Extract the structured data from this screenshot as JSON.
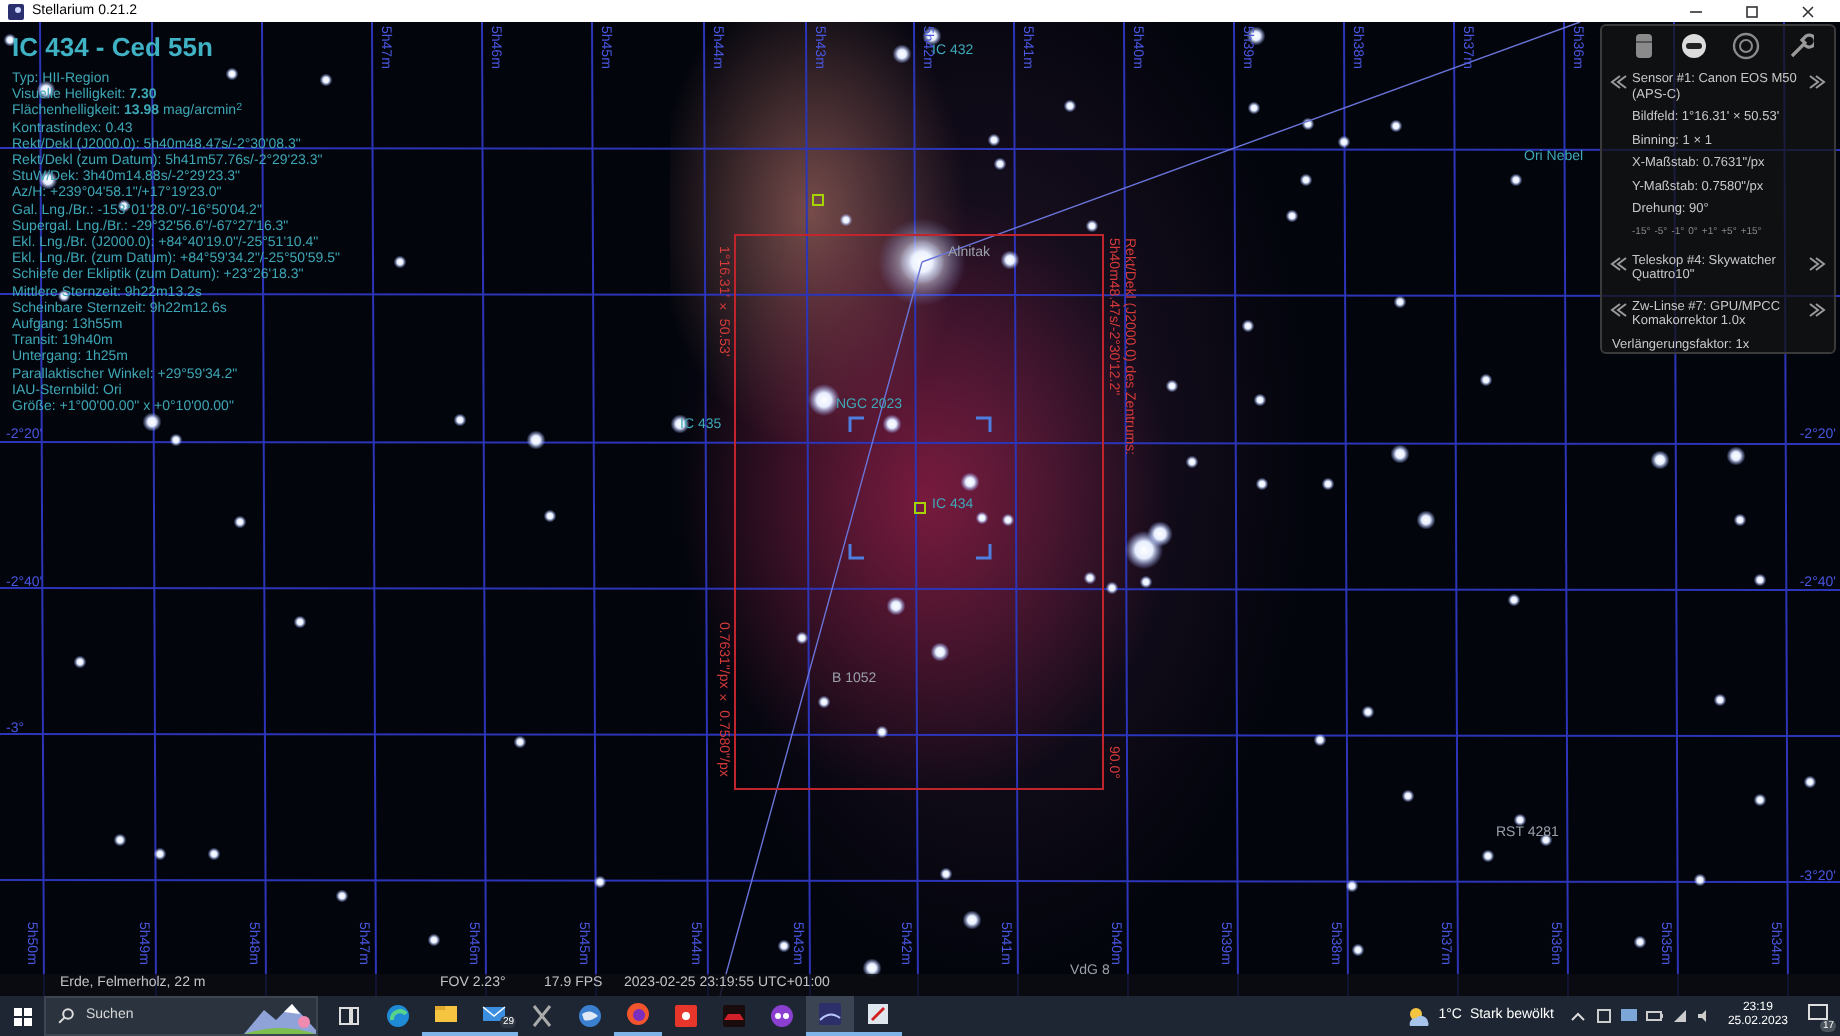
{
  "window": {
    "title": "Stellarium 0.21.2"
  },
  "info": {
    "title": "IC 434 - Ced 55n",
    "lines": [
      "Typ: HII-Region",
      "Visuelle Helligkeit: **7.30**",
      "Flächenhelligkeit: **13.98** mag/arcmin$^{2}$",
      "Kontrastindex: 0.43",
      "Rekt/Dekl (J2000.0): 5h40m48.47s/-2°30'08.3\"",
      "Rekt/Dekl (zum Datum): 5h41m57.76s/-2°29'23.3\"",
      "StuW/Dek: 3h40m14.88s/-2°29'23.3\"",
      "Az/H: +239°04'58.1\"/+17°19'23.0\"",
      "Gal. Lng./Br.: -153°01'28.0\"/-16°50'04.2\"",
      "Supergal. Lng./Br.: -29°32'56.6\"/-67°27'16.3\"",
      "Ekl. Lng./Br. (J2000.0): +84°40'19.0\"/-25°51'10.4\"",
      "Ekl. Lng./Br. (zum Datum): +84°59'34.2\"/-25°50'59.5\"",
      "Schiefe der Ekliptik (zum Datum): +23°26'18.3\"",
      "Mittlere Sternzeit: 9h22m13.2s",
      "Scheinbare Sternzeit: 9h22m12.6s",
      "Aufgang: 13h55m",
      "Transit: 19h40m",
      "Untergang: 1h25m",
      "Parallaktischer Winkel: +29°59'34.2\"",
      "IAU-Sternbild: Ori",
      "Größe: +1°00'00.00\" x +0°10'00.00\""
    ]
  },
  "sky": {
    "ra_top": [
      "5h47m",
      "5h46m",
      "5h45m",
      "5h44m",
      "5h43m",
      "5h42m",
      "5h41m",
      "5h40m",
      "5h39m",
      "5h38m",
      "5h37m",
      "5h36m"
    ],
    "ra_bottom": [
      "5h50m",
      "5h49m",
      "5h48m",
      "5h47m",
      "5h46m",
      "5h45m",
      "5h44m",
      "5h43m",
      "5h42m",
      "5h41m",
      "5h40m",
      "5h39m",
      "5h38m",
      "5h37m",
      "5h36m",
      "5h35m",
      "5h34m"
    ],
    "dec_left": [
      "-2°20'",
      "-2°40'",
      "-3°"
    ],
    "dec_right": [
      "-2°20'",
      "-2°40'",
      "-3°20'"
    ],
    "objects": [
      {
        "text": "IC 432",
        "kind": "nebula"
      },
      {
        "text": "Alnitak",
        "kind": "star"
      },
      {
        "text": "NGC 2023",
        "kind": "nebula"
      },
      {
        "text": "IC 435",
        "kind": "nebula"
      },
      {
        "text": "IC 434",
        "kind": "nebula"
      },
      {
        "text": "B 1052",
        "kind": "star"
      },
      {
        "text": "RST 4281",
        "kind": "star"
      },
      {
        "text": "VdG 8",
        "kind": "star"
      },
      {
        "text": "Ori Nebel",
        "kind": "nebula"
      }
    ],
    "frame_labels": [
      "1°16.31' × 50.53'",
      "0.7631\"/px × 0.7580\"/px",
      "Rekt/Dekl (J2000.0) des Zentrums:",
      "5h40m48.47s/-2°30'12.2\"",
      "90.0°"
    ]
  },
  "oculars": {
    "sensor": {
      "title": "Sensor #1: Canon EOS M50 (APS-C)",
      "details": [
        "Bildfeld: 1°16.31' × 50.53'",
        "Binning: 1 × 1",
        "X-Maßstab: 0.7631\"/px",
        "Y-Maßstab: 0.7580\"/px",
        "Drehung: 90°"
      ],
      "rotation_buttons": [
        "-15°",
        "-5°",
        "-1°",
        "0°",
        "+1°",
        "+5°",
        "+15°"
      ]
    },
    "telescope": {
      "title": "Teleskop #4: Skywatcher Quattro10\""
    },
    "lens": {
      "title": "Zw-Linse #7: GPU/MPCC Komakorrektor 1.0x",
      "details": [
        "Verlängerungsfaktor: 1x"
      ]
    }
  },
  "status_bar": {
    "location": "Erde, Felmerholz, 22 m",
    "fov": "FOV 2.23°",
    "fps": "17.9 FPS",
    "datetime": "2023-02-25 23:19:55 UTC+01:00"
  },
  "taskbar": {
    "search_placeholder": "Suchen",
    "apps": [
      {
        "kind": "task-view",
        "running": false,
        "selected": false
      },
      {
        "kind": "edge",
        "running": false,
        "selected": false
      },
      {
        "kind": "explorer",
        "running": true,
        "selected": false
      },
      {
        "kind": "mail",
        "running": true,
        "selected": false,
        "badge": "29"
      },
      {
        "kind": "xapp",
        "running": false,
        "selected": false
      },
      {
        "kind": "globe",
        "running": false,
        "selected": false
      },
      {
        "kind": "firefox",
        "running": true,
        "selected": false
      },
      {
        "kind": "record",
        "running": false,
        "selected": false
      },
      {
        "kind": "car",
        "running": false,
        "selected": false
      },
      {
        "kind": "mascot",
        "running": false,
        "selected": false
      },
      {
        "kind": "stellarium",
        "running": true,
        "selected": true
      },
      {
        "kind": "tool",
        "running": true,
        "selected": false
      }
    ],
    "weather": {
      "temperature": "1°C",
      "condition": "Stark bewölkt"
    },
    "clock": {
      "time": "23:19",
      "date": "25.02.2023"
    },
    "notifications": "17"
  }
}
